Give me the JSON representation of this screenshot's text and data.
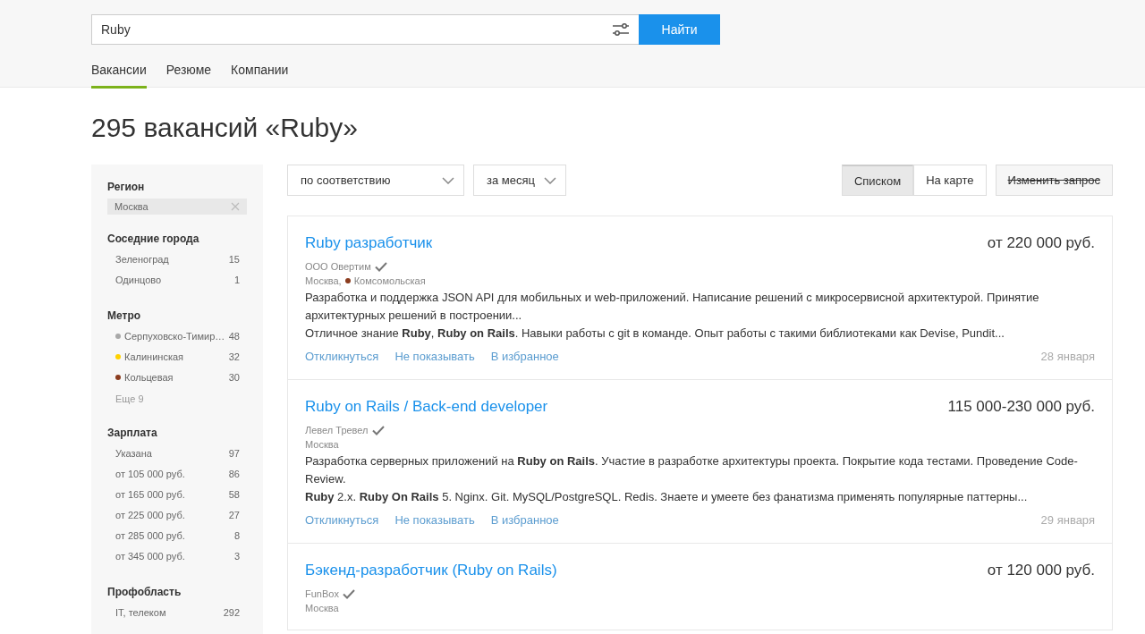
{
  "search": {
    "value": "Ruby",
    "button": "Найти"
  },
  "tabs": [
    {
      "label": "Вакансии",
      "selected": true
    },
    {
      "label": "Резюме",
      "selected": false
    },
    {
      "label": "Компании",
      "selected": false
    }
  ],
  "heading": "295 вакансий «Ruby»",
  "sidebar": {
    "groups": [
      {
        "title": "Регион",
        "chip": "Москва"
      },
      {
        "title": "Соседние города",
        "items": [
          {
            "label": "Зеленоград",
            "count": "15"
          },
          {
            "label": "Одинцово",
            "count": "1"
          }
        ]
      },
      {
        "title": "Метро",
        "items": [
          {
            "label": "Серпуховско-Тимир…",
            "count": "48",
            "color": "#a8a8a8"
          },
          {
            "label": "Калининская",
            "count": "32",
            "color": "#ffd200"
          },
          {
            "label": "Кольцевая",
            "count": "30",
            "color": "#8b3c1e"
          }
        ],
        "more": "Еще 9"
      },
      {
        "title": "Зарплата",
        "items": [
          {
            "label": "Указана",
            "count": "97"
          },
          {
            "label": "от 105 000 руб.",
            "count": "86"
          },
          {
            "label": "от 165 000 руб.",
            "count": "58"
          },
          {
            "label": "от 225 000 руб.",
            "count": "27"
          },
          {
            "label": "от 285 000 руб.",
            "count": "8"
          },
          {
            "label": "от 345 000 руб.",
            "count": "3"
          }
        ]
      },
      {
        "title": "Профобласть",
        "items": [
          {
            "label": "IT, телеком",
            "count": "292"
          }
        ]
      }
    ]
  },
  "toolbar": {
    "sort": "по соответствию",
    "period": "за месяц",
    "views": [
      {
        "label": "Списком",
        "selected": true
      },
      {
        "label": "На карте",
        "selected": false
      }
    ],
    "edit": "Изменить запрос"
  },
  "vacancies": [
    {
      "title": "Ruby разработчик",
      "salary": "от 220 000 руб.",
      "company": "ООО Овертим",
      "city": "Москва,",
      "metro": {
        "name": "Комсомольская",
        "color": "#8b3c1e"
      },
      "description": [
        "Разработка и поддержка JSON API для мобильных и web-приложений. Написание решений с микросервисной архитектурой. Принятие архитектурных решений в построении...",
        "Отличное знание **Ruby**, **Ruby on Rails**. Навыки работы с git в команде. Опыт работы с такими библиотеками как Devise, Pundit..."
      ],
      "actions": [
        "Откликнуться",
        "Не показывать",
        "В избранное"
      ],
      "date": "28 января"
    },
    {
      "title": "Ruby on Rails / Back-end developer",
      "salary": "115 000-230 000 руб.",
      "company": "Левел Тревел",
      "city": "Москва",
      "description": [
        "Разработка серверных приложений на **Ruby on Rails**. Участие в разработке архитектуры проекта. Покрытие кода тестами. Проведение Code-Review.",
        "**Ruby** 2.x. **Ruby On Rails** 5. Nginx. Git. MySQL/PostgreSQL. Redis. Знаете и умеете без фанатизма применять популярные паттерны..."
      ],
      "actions": [
        "Откликнуться",
        "Не показывать",
        "В избранное"
      ],
      "date": "29 января"
    },
    {
      "title": "Бэкенд-разработчик (Ruby on Rails)",
      "salary": "от 120 000 руб.",
      "company": "FunBox",
      "city": "Москва"
    }
  ]
}
